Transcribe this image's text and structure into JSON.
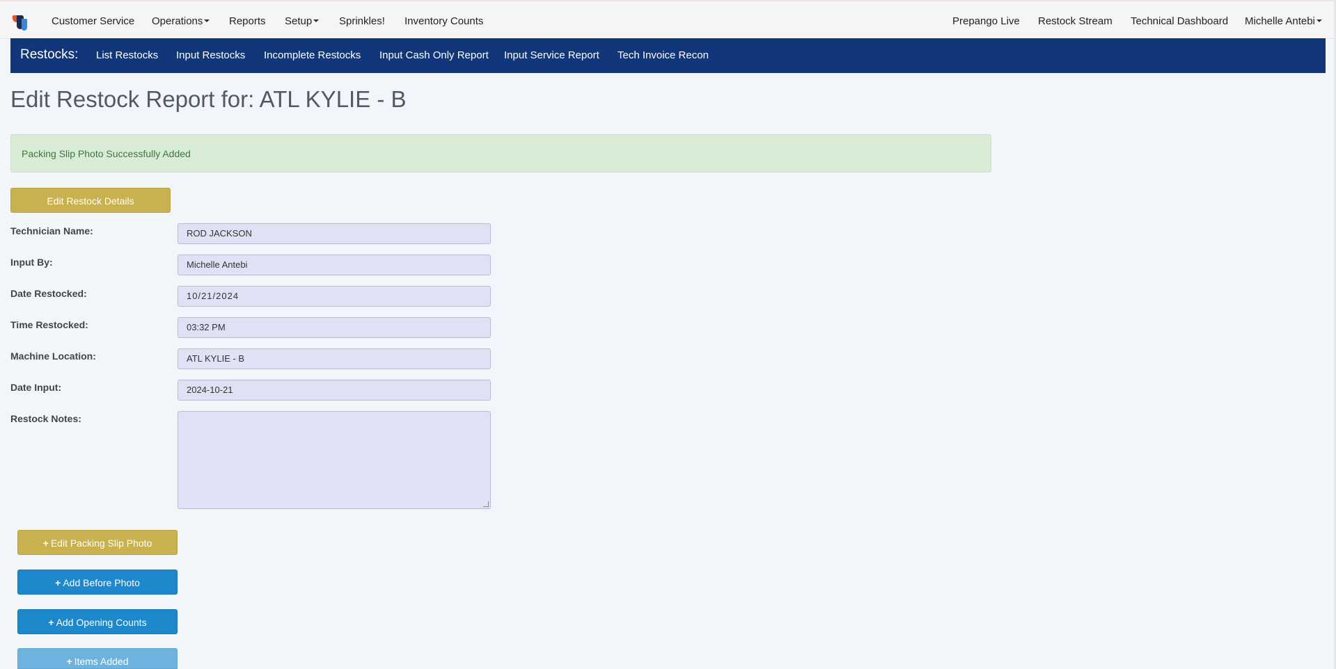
{
  "topnav": {
    "items": [
      {
        "label": "Customer Service",
        "dropdown": false
      },
      {
        "label": "Operations",
        "dropdown": true
      },
      {
        "label": "Reports",
        "dropdown": false
      },
      {
        "label": "Setup",
        "dropdown": true
      },
      {
        "label": "Sprinkles!",
        "dropdown": false
      },
      {
        "label": "Inventory Counts",
        "dropdown": false
      }
    ],
    "right_items": [
      {
        "label": "Prepango Live"
      },
      {
        "label": "Restock Stream"
      },
      {
        "label": "Technical Dashboard"
      },
      {
        "label": "Michelle Antebi",
        "dropdown": true
      }
    ]
  },
  "subnav": {
    "brand": "Restocks:",
    "items": [
      "List Restocks",
      "Input Restocks",
      "Incomplete Restocks",
      "Input Cash Only Report",
      "Input Service Report",
      "Tech Invoice Recon"
    ]
  },
  "page": {
    "title": "Edit Restock Report for: ATL KYLIE - B",
    "alert": "Packing Slip Photo Successfully Added",
    "edit_details_button": "Edit Restock Details"
  },
  "form": {
    "technician_label": "Technician Name:",
    "technician_value": "ROD JACKSON",
    "input_by_label": "Input By:",
    "input_by_value": "Michelle Antebi",
    "date_restocked_label": "Date Restocked:",
    "date_restocked_value": "10/21/2024",
    "time_restocked_label": "Time Restocked:",
    "time_restocked_value": "03:32 PM",
    "machine_location_label": "Machine Location:",
    "machine_location_value": "ATL KYLIE - B",
    "date_input_label": "Date Input:",
    "date_input_value": "2024-10-21",
    "notes_label": "Restock Notes:",
    "notes_value": ""
  },
  "actions": {
    "plus": "+",
    "edit_packing_slip": "Edit Packing Slip Photo",
    "add_before_photo": "Add Before Photo",
    "add_opening_counts": "Add Opening Counts",
    "items_added": "Items Added"
  },
  "colors": {
    "navy": "#12367a",
    "gold": "#c8b14e",
    "blue": "#1e88cc",
    "light_blue": "#6db3dd",
    "alert_bg": "#d9edd6",
    "input_bg": "#e1e1f6"
  }
}
